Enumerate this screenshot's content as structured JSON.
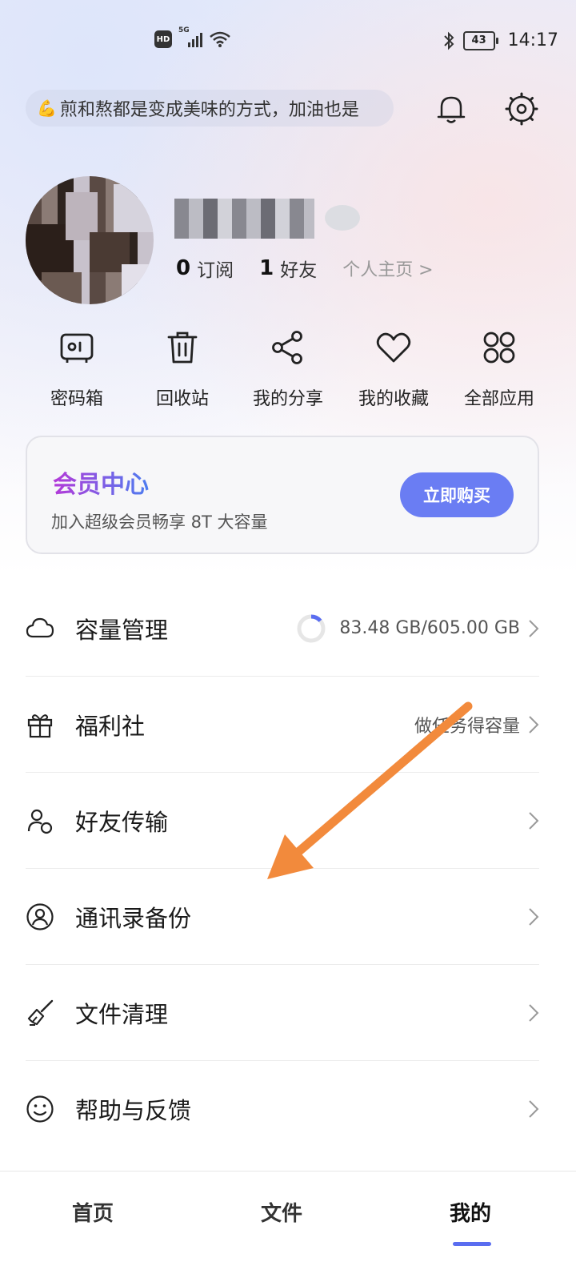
{
  "status_bar": {
    "hd": "HD",
    "network": "5G",
    "battery": "43",
    "time": "14:17"
  },
  "header": {
    "motto": "煎和熬都是变成美味的方式，加油也是"
  },
  "profile": {
    "subscribe_count": "0",
    "subscribe_label": "订阅",
    "friend_count": "1",
    "friend_label": "好友",
    "homepage_link": "个人主页 >"
  },
  "shortcuts": [
    {
      "label": "密码箱",
      "icon": "safe-box-icon"
    },
    {
      "label": "回收站",
      "icon": "trash-icon"
    },
    {
      "label": "我的分享",
      "icon": "share-icon"
    },
    {
      "label": "我的收藏",
      "icon": "heart-icon"
    },
    {
      "label": "全部应用",
      "icon": "apps-grid-icon"
    }
  ],
  "vip": {
    "title": "会员中心",
    "subtitle": "加入超级会员畅享 8T 大容量",
    "button": "立即购买"
  },
  "menu": [
    {
      "label": "容量管理",
      "icon": "cloud-icon",
      "right_text": "83.48 GB/605.00 GB"
    },
    {
      "label": "福利社",
      "icon": "gift-icon",
      "right_text": "做任务得容量"
    },
    {
      "label": "好友传输",
      "icon": "friend-transfer-icon",
      "right_text": ""
    },
    {
      "label": "通讯录备份",
      "icon": "contact-icon",
      "right_text": ""
    },
    {
      "label": "文件清理",
      "icon": "broom-icon",
      "right_text": ""
    },
    {
      "label": "帮助与反馈",
      "icon": "smile-icon",
      "right_text": ""
    }
  ],
  "storage_used_fraction": 0.138,
  "bottom_nav": {
    "home": "首页",
    "files": "文件",
    "mine": "我的"
  },
  "colors": {
    "accent": "#6a7df3",
    "arrow": "#f28a3c"
  }
}
